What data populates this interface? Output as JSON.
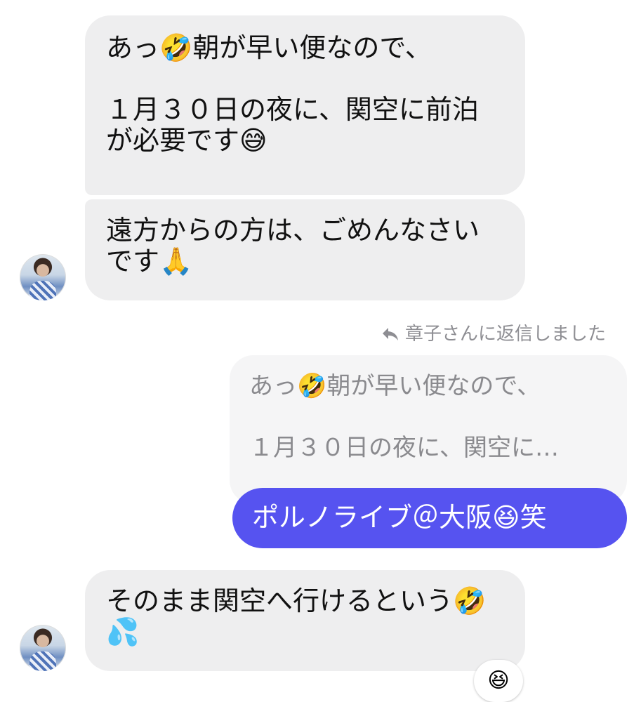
{
  "messages": {
    "incoming_1": "あっ🤣朝が早い便なので、\n\n１月３０日の夜に、関空に前泊が必要です😅",
    "incoming_2": "遠方からの方は、ごめんなさいです🙏",
    "reply_label": "章子さんに返信しました",
    "quoted_text": "あっ🤣朝が早い便なので、\n\n１月３０日の夜に、関空に…",
    "outgoing": "ポルノライブ＠大阪😆笑",
    "incoming_3": "そのまま関空へ行けるという🤣💦",
    "reaction": "😆"
  },
  "icons": {
    "reply": "reply-arrow-icon",
    "avatar": "user-avatar"
  },
  "colors": {
    "incoming_bubble": "#eeeeef",
    "outgoing_bubble": "#5653f0",
    "quote_bubble": "#f5f5f6",
    "secondary_text": "#8e8e93"
  }
}
